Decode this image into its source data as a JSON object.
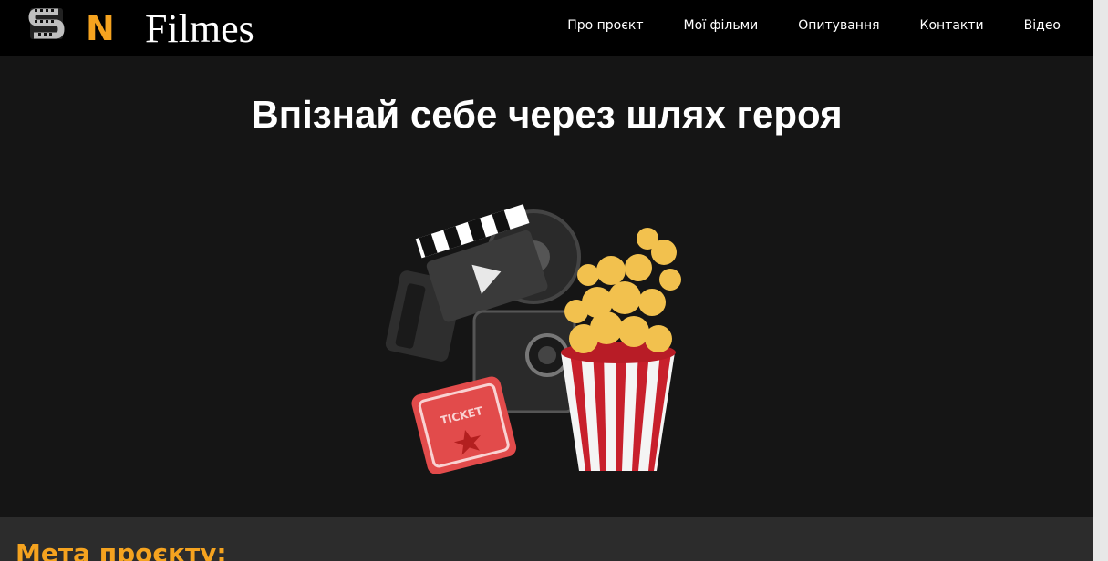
{
  "header": {
    "logo_letter": "N",
    "brand": "Filmes",
    "nav": [
      "Про проєкт",
      "Мої фільми",
      "Опитування",
      "Контакти",
      "Відео"
    ]
  },
  "hero": {
    "title": "Впізнай себе через шлях героя",
    "ticket_text": "TICKET"
  },
  "goal": {
    "title": "Мета проєкту:"
  },
  "colors": {
    "accent": "#f5a31f",
    "header_bg": "#000000",
    "page_bg": "#151515",
    "section_bg": "#2c2c2c"
  }
}
